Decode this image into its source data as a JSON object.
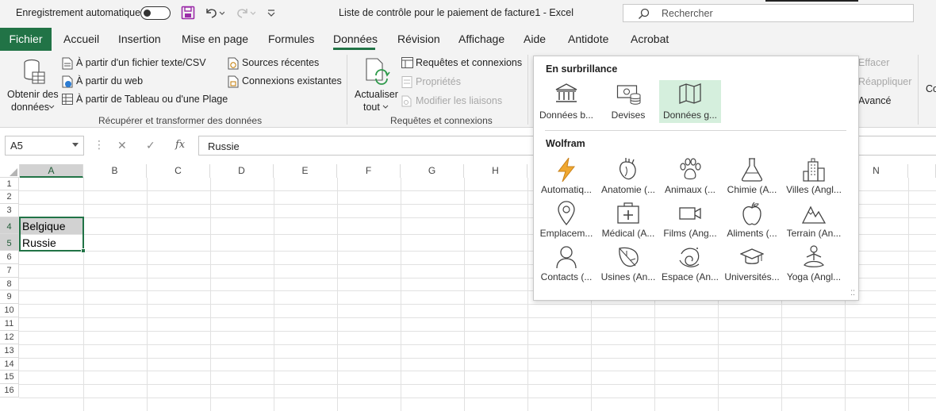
{
  "titlebar": {
    "autosave_label": "Enregistrement automatique",
    "doc_title": "Liste de contrôle pour le paiement de facture1  -  Excel",
    "search_placeholder": "Rechercher"
  },
  "tabs": [
    "Fichier",
    "Accueil",
    "Insertion",
    "Mise en page",
    "Formules",
    "Données",
    "Révision",
    "Affichage",
    "Aide",
    "Antidote",
    "Acrobat"
  ],
  "active_tab": "Données",
  "ribbon": {
    "get_data": {
      "line1": "Obtenir des",
      "line2": "données"
    },
    "from_text": "À partir d'un fichier texte/CSV",
    "from_web": "À partir du web",
    "from_table": "À partir de Tableau ou d'une Plage",
    "recent_sources": "Sources récentes",
    "existing_connections": "Connexions existantes",
    "group1_label": "Récupérer et transformer des données",
    "refresh": {
      "line1": "Actualiser",
      "line2": "tout"
    },
    "queries_connections": "Requêtes et connexions",
    "properties": "Propriétés",
    "edit_links": "Modifier les liaisons",
    "group2_label": "Requêtes et connexions",
    "clear": "Effacer",
    "reapply": "Réappliquer",
    "advanced": "Avancé",
    "cut_label": "Co"
  },
  "formula_bar": {
    "name_box": "A5",
    "formula": "Russie"
  },
  "grid": {
    "columns": [
      "A",
      "B",
      "C",
      "D",
      "E",
      "F",
      "G",
      "H",
      "N"
    ],
    "rows": [
      "1",
      "2",
      "3",
      "4",
      "5",
      "6",
      "7",
      "8",
      "9",
      "10",
      "11",
      "12",
      "13",
      "14",
      "15",
      "16"
    ],
    "cells": {
      "A4": "Belgique",
      "A5": "Russie"
    }
  },
  "gallery": {
    "section1": "En surbrillance",
    "featured": [
      {
        "label": "Données b...",
        "icon": "bank-icon"
      },
      {
        "label": "Devises",
        "icon": "currency-icon"
      },
      {
        "label": "Données g...",
        "icon": "map-icon"
      }
    ],
    "section2": "Wolfram",
    "wolfram": [
      {
        "label": "Automatiq...",
        "icon": "lightning-icon"
      },
      {
        "label": "Anatomie (...",
        "icon": "heart-icon"
      },
      {
        "label": "Animaux (...",
        "icon": "paw-icon"
      },
      {
        "label": "Chimie (A...",
        "icon": "flask-icon"
      },
      {
        "label": "Villes (Angl...",
        "icon": "city-icon"
      },
      {
        "label": "Emplacem...",
        "icon": "location-pin-icon"
      },
      {
        "label": "Médical (A...",
        "icon": "medical-kit-icon"
      },
      {
        "label": "Films (Ang...",
        "icon": "video-camera-icon"
      },
      {
        "label": "Aliments (...",
        "icon": "apple-icon"
      },
      {
        "label": "Terrain (An...",
        "icon": "mountain-icon"
      },
      {
        "label": "Contacts (...",
        "icon": "person-icon"
      },
      {
        "label": "Usines (An...",
        "icon": "leaf-icon"
      },
      {
        "label": "Espace (An...",
        "icon": "galaxy-icon"
      },
      {
        "label": "Universités...",
        "icon": "graduation-cap-icon"
      },
      {
        "label": "Yoga (Angl...",
        "icon": "yoga-icon"
      }
    ]
  },
  "colors": {
    "excel_green": "#217346",
    "accent_orange": "#e8a33a",
    "highlight": "#d5efdd"
  }
}
